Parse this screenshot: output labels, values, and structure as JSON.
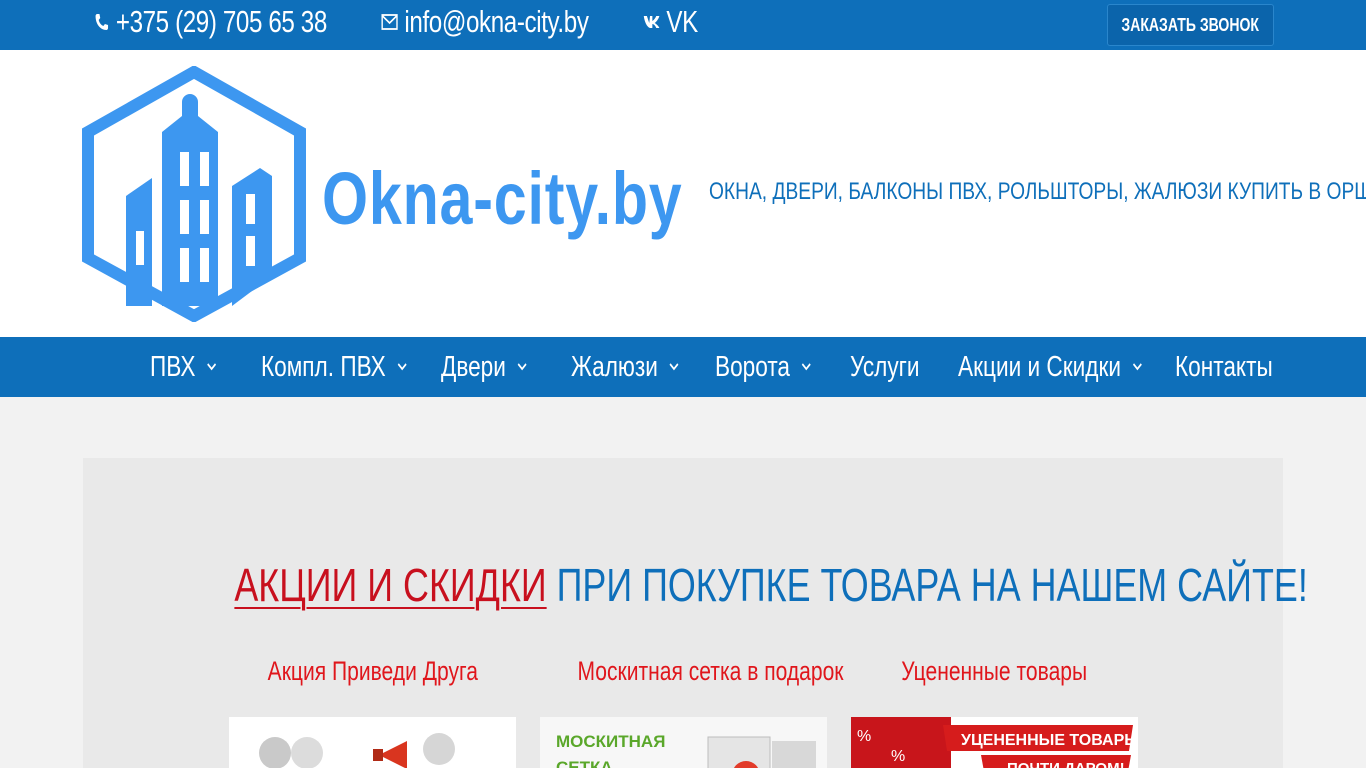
{
  "topbar": {
    "phone": "+375 (29) 705 65 38",
    "email": "info@okna-city.by",
    "vk": "VK",
    "call_button": "ЗАКАЗАТЬ ЗВОНОК",
    "colors": {
      "bar": "#0e6fba",
      "text": "#ffffff"
    }
  },
  "header": {
    "logo_text": "Okna-city.by",
    "tagline": "ОКНА, ДВЕРИ, БАЛКОНЫ ПВХ, РОЛЬШТОРЫ, ЖАЛЮЗИ КУПИТЬ В ОРШЕ",
    "colors": {
      "logo": "#3d97f0",
      "tagline": "#0e6fba"
    }
  },
  "nav": {
    "items": [
      {
        "label": "ПВХ",
        "has_dropdown": true
      },
      {
        "label": "Компл. ПВХ",
        "has_dropdown": true
      },
      {
        "label": "Двери",
        "has_dropdown": true
      },
      {
        "label": "Жалюзи",
        "has_dropdown": true
      },
      {
        "label": "Ворота",
        "has_dropdown": true
      },
      {
        "label": "Услуги",
        "has_dropdown": false
      },
      {
        "label": "Акции и Скидки",
        "has_dropdown": true
      },
      {
        "label": "Контакты",
        "has_dropdown": false
      }
    ]
  },
  "main": {
    "headline_link": "АКЦИИ И СКИДКИ",
    "headline_rest": "ПРИ ПОКУПКЕ ТОВАРА НА НАШЕМ САЙТЕ!",
    "cards": [
      {
        "title": "Акция Приведи Друга",
        "image_text": ""
      },
      {
        "title": "Москитная сетка в подарок",
        "image_text_1": "МОСКИТНАЯ",
        "image_text_2": "СЕТКА"
      },
      {
        "title": "Уцененные товары",
        "image_text_1": "УЦЕНЕННЫЕ ТОВАРЫ!",
        "image_text_2": "ПОЧТИ ДАРОМ!"
      }
    ],
    "colors": {
      "accent_red": "#c8101e",
      "accent_blue": "#0e6fba"
    }
  }
}
